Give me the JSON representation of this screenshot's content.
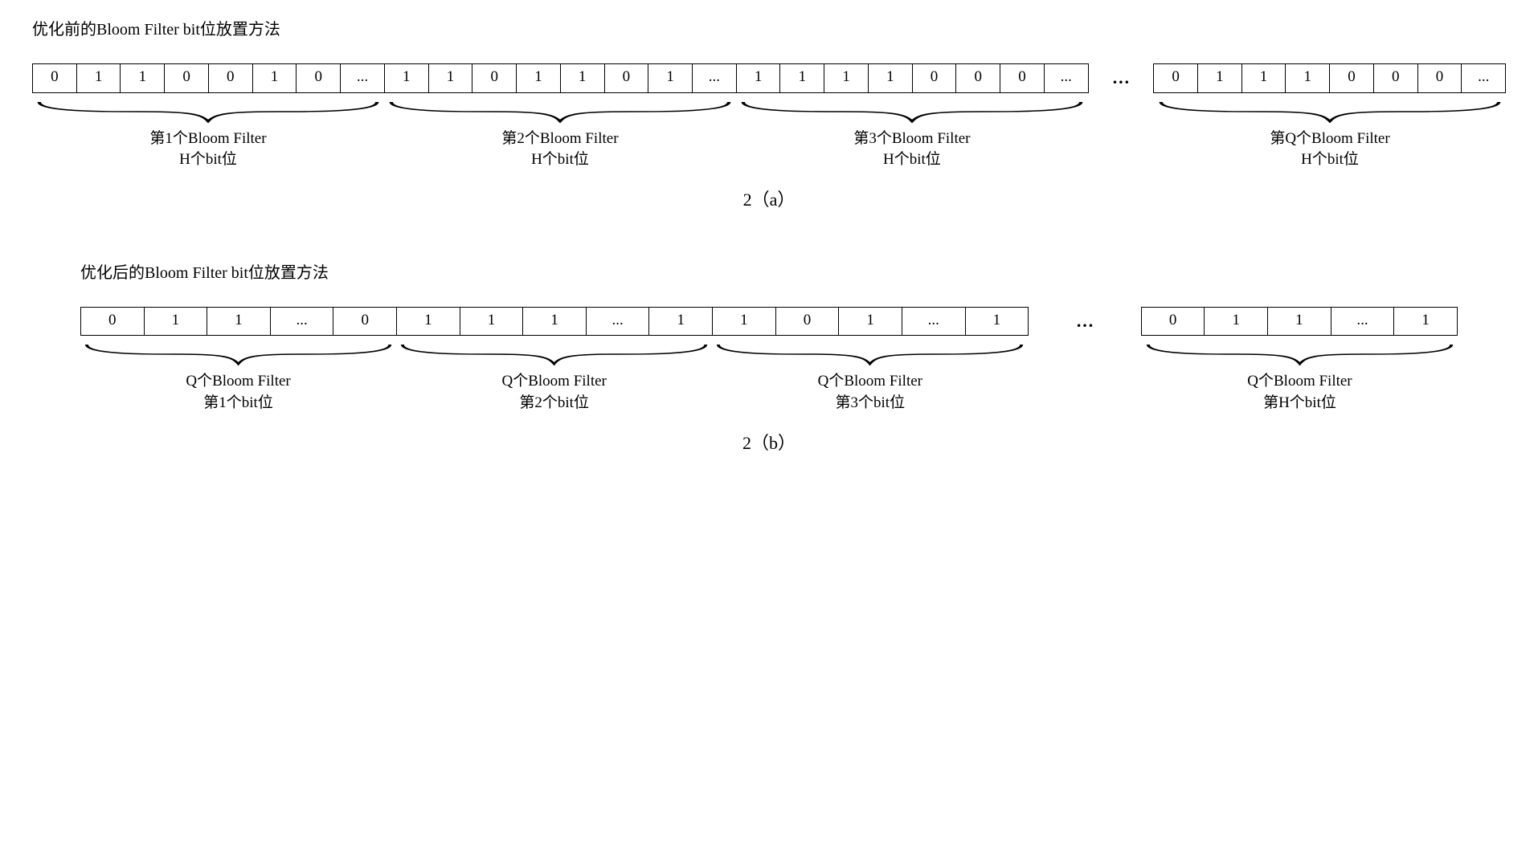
{
  "section_a": {
    "title": "优化前的Bloom Filter  bit位放置方法",
    "bits": [
      "0",
      "1",
      "1",
      "0",
      "0",
      "1",
      "0",
      "...",
      "1",
      "1",
      "0",
      "1",
      "1",
      "0",
      "1",
      "...",
      "1",
      "1",
      "1",
      "1",
      "0",
      "0",
      "0",
      "...",
      "ELLIPSIS",
      "0",
      "1",
      "1",
      "1",
      "0",
      "0",
      "0",
      "..."
    ],
    "groups": [
      {
        "label_line1": "第1个Bloom Filter",
        "label_line2": "H个bit位"
      },
      {
        "label_line1": "第2个Bloom Filter",
        "label_line2": "H个bit位"
      },
      {
        "label_line1": "第3个Bloom Filter",
        "label_line2": "H个bit位"
      },
      {
        "label_line1": "第Q个Bloom Filter",
        "label_line2": "H个bit位"
      }
    ],
    "figure_label": "2（a）"
  },
  "section_b": {
    "title": "优化后的Bloom Filter bit位放置方法",
    "bits": [
      "0",
      "1",
      "1",
      "...",
      "0",
      "1",
      "1",
      "1",
      "...",
      "1",
      "1",
      "0",
      "1",
      "...",
      "1",
      "ELLIPSIS",
      "0",
      "1",
      "1",
      "...",
      "1"
    ],
    "groups": [
      {
        "label_line1": "Q个Bloom Filter",
        "label_line2": "第1个bit位"
      },
      {
        "label_line1": "Q个Bloom Filter",
        "label_line2": "第2个bit位"
      },
      {
        "label_line1": "Q个Bloom Filter",
        "label_line2": "第3个bit位"
      },
      {
        "label_line1": "Q个Bloom Filter",
        "label_line2": "第H个bit位"
      }
    ],
    "figure_label": "2（b）"
  }
}
